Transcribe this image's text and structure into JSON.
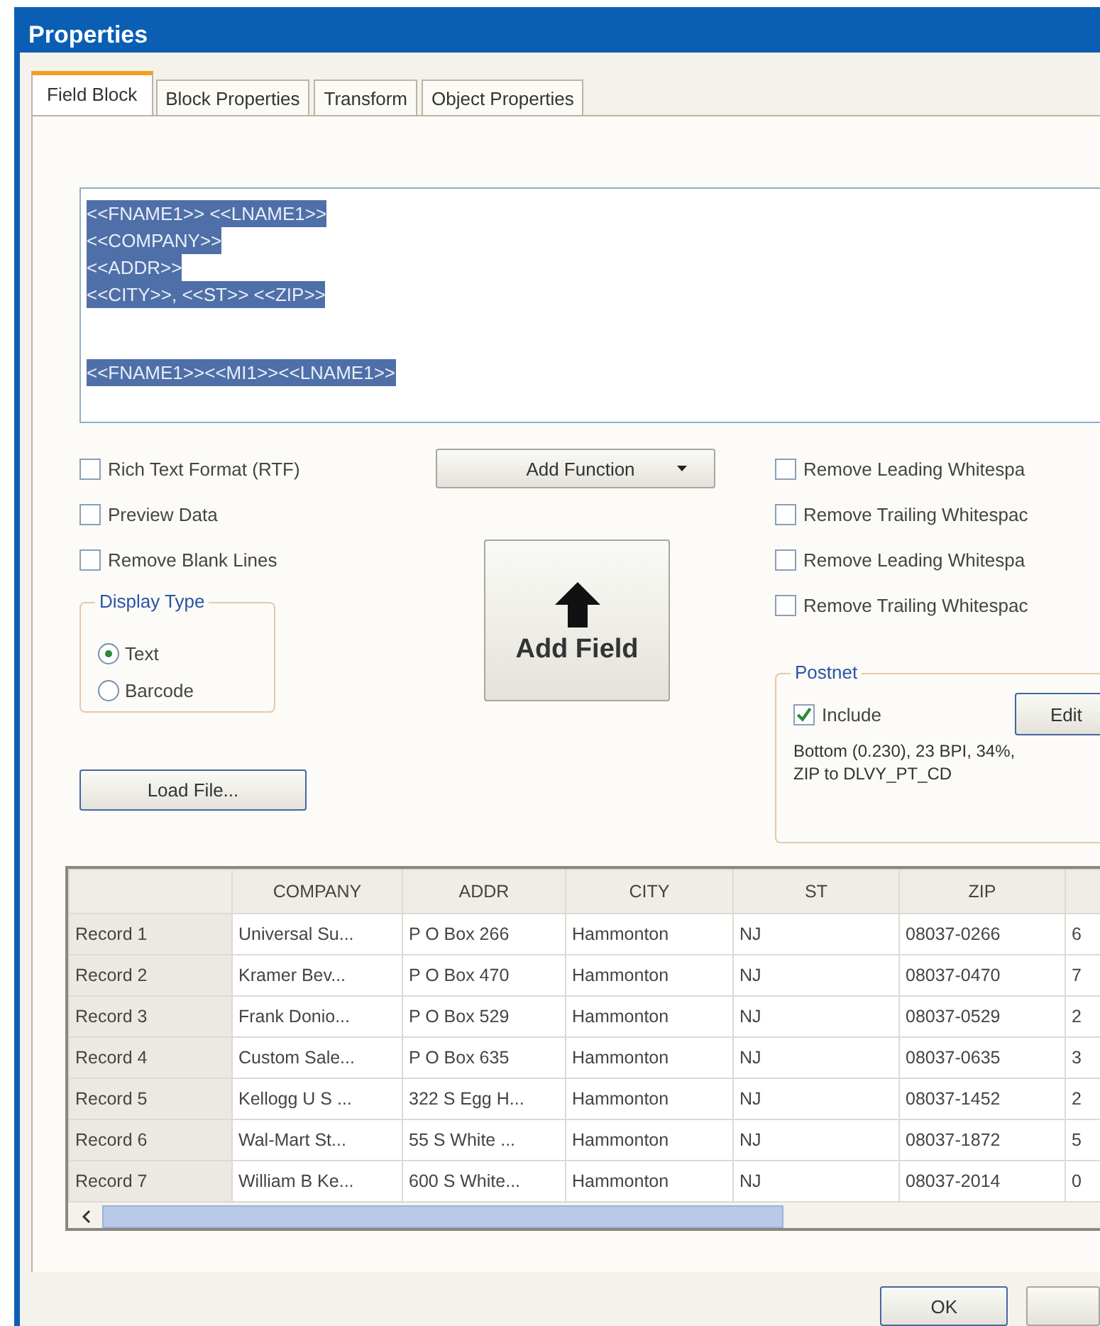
{
  "window": {
    "title": "Properties"
  },
  "tabs": [
    {
      "label": "Field Block",
      "selected": true
    },
    {
      "label": "Block Properties",
      "selected": false
    },
    {
      "label": "Transform",
      "selected": false
    },
    {
      "label": "Object Properties",
      "selected": false
    }
  ],
  "editor": {
    "paragraphs": [
      [
        "<<FNAME1>> <<LNAME1>>",
        "<<COMPANY>>",
        "<<ADDR>>",
        "<<CITY>>, <<ST>> <<ZIP>>"
      ],
      [
        "<<FNAME1>><<MI1>><<LNAME1>>"
      ]
    ],
    "selected": true
  },
  "left_options": [
    {
      "label": "Rich Text Format (RTF)",
      "checked": false
    },
    {
      "label": "Preview Data",
      "checked": false
    },
    {
      "label": "Remove Blank Lines",
      "checked": false
    }
  ],
  "add_function": {
    "label": "Add Function"
  },
  "right_options": [
    {
      "label": "Remove Leading Whitespa",
      "checked": false
    },
    {
      "label": "Remove Trailing Whitespac",
      "checked": false
    },
    {
      "label": "Remove Leading Whitespa",
      "checked": false
    },
    {
      "label": "Remove Trailing Whitespac",
      "checked": false
    }
  ],
  "display_type": {
    "title": "Display Type",
    "options": [
      {
        "label": "Text",
        "selected": true
      },
      {
        "label": "Barcode",
        "selected": false
      }
    ]
  },
  "add_field": {
    "label": "Add Field"
  },
  "load_file": {
    "label": "Load File..."
  },
  "postnet": {
    "title": "Postnet",
    "include": {
      "label": "Include",
      "checked": true
    },
    "edit_button": "Edit",
    "summary": [
      "Bottom (0.230), 23 BPI, 34%,",
      "ZIP to DLVY_PT_CD"
    ]
  },
  "table": {
    "columns": [
      "COMPANY",
      "ADDR",
      "CITY",
      "ST",
      "ZIP"
    ],
    "rows": [
      {
        "label": "Record 1",
        "cells": [
          "Universal Su...",
          "P O Box 266",
          "Hammonton",
          "NJ",
          "08037-0266",
          "6"
        ]
      },
      {
        "label": "Record 2",
        "cells": [
          "Kramer Bev...",
          "P O Box 470",
          "Hammonton",
          "NJ",
          "08037-0470",
          "7"
        ]
      },
      {
        "label": "Record 3",
        "cells": [
          "Frank Donio...",
          "P O Box 529",
          "Hammonton",
          "NJ",
          "08037-0529",
          "2"
        ]
      },
      {
        "label": "Record 4",
        "cells": [
          "Custom Sale...",
          "P O Box 635",
          "Hammonton",
          "NJ",
          "08037-0635",
          "3"
        ]
      },
      {
        "label": "Record 5",
        "cells": [
          "Kellogg U S ...",
          "322 S Egg H...",
          "Hammonton",
          "NJ",
          "08037-1452",
          "2"
        ]
      },
      {
        "label": "Record 6",
        "cells": [
          "Wal-Mart St...",
          "55 S White ...",
          "Hammonton",
          "NJ",
          "08037-1872",
          "5"
        ]
      },
      {
        "label": "Record 7",
        "cells": [
          "William B Ke...",
          "600 S White...",
          "Hammonton",
          "NJ",
          "08037-2014",
          "0"
        ]
      }
    ]
  },
  "buttons": [
    "OK"
  ]
}
